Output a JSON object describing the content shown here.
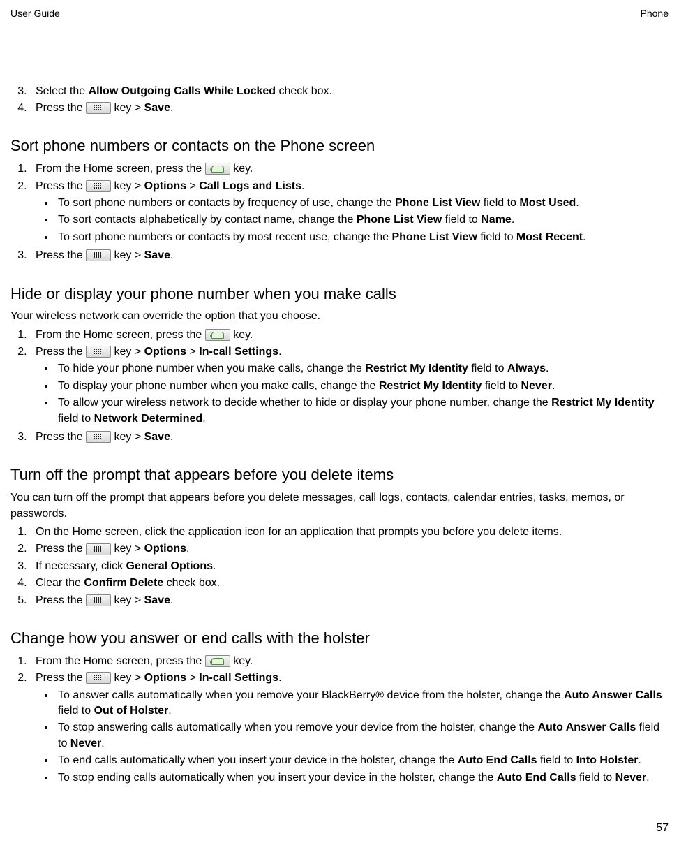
{
  "header": {
    "left": "User Guide",
    "right": "Phone"
  },
  "sec0": {
    "step3": {
      "pre": "Select the ",
      "b1": "Allow Outgoing Calls While Locked",
      "post": " check box."
    },
    "step4": {
      "pre": "Press the ",
      "mid": " key > ",
      "b1": "Save",
      "post": "."
    }
  },
  "sec1": {
    "title": "Sort phone numbers or contacts on the Phone screen",
    "s1": {
      "pre": "From the Home screen, press the ",
      "post": " key."
    },
    "s2": {
      "pre": "Press the ",
      "mid": " key > ",
      "b1": "Options",
      "sep": " > ",
      "b2": "Call Logs and Lists",
      "post": "."
    },
    "b1": {
      "pre": "To sort phone numbers or contacts by frequency of use, change the ",
      "bold1": "Phone List View",
      "mid1": " field to ",
      "bold2": "Most Used",
      "post": "."
    },
    "b2": {
      "pre": "To sort contacts alphabetically by contact name, change the ",
      "bold1": "Phone List View",
      "mid1": " field to ",
      "bold2": "Name",
      "post": "."
    },
    "b3": {
      "pre": "To sort phone numbers or contacts by most recent use, change the ",
      "bold1": "Phone List View",
      "mid1": " field to ",
      "bold2": "Most Recent",
      "post": "."
    },
    "s3": {
      "pre": "Press the ",
      "mid": " key > ",
      "b1": "Save",
      "post": "."
    }
  },
  "sec2": {
    "title": "Hide or display your phone number when you make calls",
    "intro": "Your wireless network can override the option that you choose.",
    "s1": {
      "pre": "From the Home screen, press the ",
      "post": " key."
    },
    "s2": {
      "pre": "Press the ",
      "mid": " key > ",
      "b1": "Options",
      "sep": " > ",
      "b2": "In-call Settings",
      "post": "."
    },
    "b1": {
      "pre": "To hide your phone number when you make calls, change the ",
      "bold1": "Restrict My Identity",
      "mid1": " field to ",
      "bold2": "Always",
      "post": "."
    },
    "b2": {
      "pre": "To display your phone number when you make calls, change the ",
      "bold1": "Restrict My Identity",
      "mid1": " field to ",
      "bold2": "Never",
      "post": "."
    },
    "b3": {
      "pre": "To allow your wireless network to decide whether to hide or display your phone number, change the ",
      "bold1": "Restrict My Identity",
      "mid1": " field to ",
      "bold2": "Network Determined",
      "post": "."
    },
    "s3": {
      "pre": "Press the ",
      "mid": " key > ",
      "b1": "Save",
      "post": "."
    }
  },
  "sec3": {
    "title": "Turn off the prompt that appears before you delete items",
    "intro": "You can turn off the prompt that appears before you delete messages, call logs, contacts, calendar entries, tasks, memos, or passwords.",
    "s1": "On the Home screen, click the application icon for an application that prompts you before you delete items.",
    "s2": {
      "pre": "Press the ",
      "mid": " key > ",
      "b1": "Options",
      "post": "."
    },
    "s3": {
      "pre": "If necessary, click ",
      "b1": "General Options",
      "post": "."
    },
    "s4": {
      "pre": "Clear the ",
      "b1": "Confirm Delete",
      "post": " check box."
    },
    "s5": {
      "pre": "Press the ",
      "mid": " key > ",
      "b1": "Save",
      "post": "."
    }
  },
  "sec4": {
    "title": "Change how you answer or end calls with the holster",
    "s1": {
      "pre": "From the Home screen, press the ",
      "post": " key."
    },
    "s2": {
      "pre": "Press the ",
      "mid": " key > ",
      "b1": "Options",
      "sep": " > ",
      "b2": "In-call Settings",
      "post": "."
    },
    "b1": {
      "pre": "To answer calls automatically when you remove your BlackBerry® device from the holster, change the ",
      "bold1": "Auto Answer Calls",
      "mid1": " field to ",
      "bold2": "Out of Holster",
      "post": "."
    },
    "b2": {
      "pre": "To stop answering calls automatically when you remove your device from the holster, change the ",
      "bold1": "Auto Answer Calls",
      "mid1": " field to ",
      "bold2": "Never",
      "post": "."
    },
    "b3": {
      "pre": "To end calls automatically when you insert your device in the holster, change the ",
      "bold1": "Auto End Calls",
      "mid1": " field to ",
      "bold2": "Into Holster",
      "post": "."
    },
    "b4": {
      "pre": "To stop ending calls automatically when you insert your device in the holster, change the ",
      "bold1": "Auto End Calls",
      "mid1": " field to ",
      "bold2": "Never",
      "post": "."
    }
  },
  "pageNumber": "57"
}
